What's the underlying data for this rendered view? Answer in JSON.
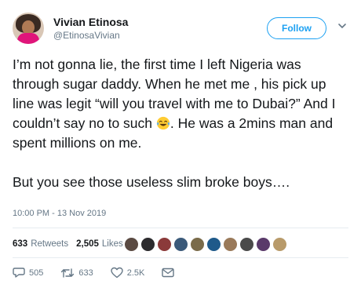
{
  "user": {
    "name": "Vivian Etinosa",
    "handle": "@EtinosaVivian",
    "follow_label": "Follow"
  },
  "tweet": {
    "text_part1": "I’m not gonna lie, the first time I left Nigeria was through sugar daddy. When he met me , his pick up line was legit “will you travel with me to Dubai?” And I couldn’t say no to such ",
    "text_part2": ". He was a 2mins man and spent millions on me.",
    "text_p2": "But you see those useless slim broke boys….",
    "emoji": "laughing-crying-emoji",
    "timestamp": "10:00 PM - 13 Nov 2019"
  },
  "stats": {
    "retweets_count": "633",
    "retweets_label": "Retweets",
    "likes_count": "2,505",
    "likes_label": "Likes"
  },
  "liker_avatar_colors": [
    "#5a4a42",
    "#2c2b2e",
    "#8b3a3a",
    "#3b5a7a",
    "#7a6b4a",
    "#1f5a8a",
    "#9a7a5a",
    "#4a4a4a",
    "#5a3a6a",
    "#b89a6a"
  ],
  "actions": {
    "replies": "505",
    "retweets": "633",
    "likes": "2.5K"
  },
  "colors": {
    "accent": "#1da1f2",
    "secondary": "#657786",
    "text": "#14171a"
  }
}
